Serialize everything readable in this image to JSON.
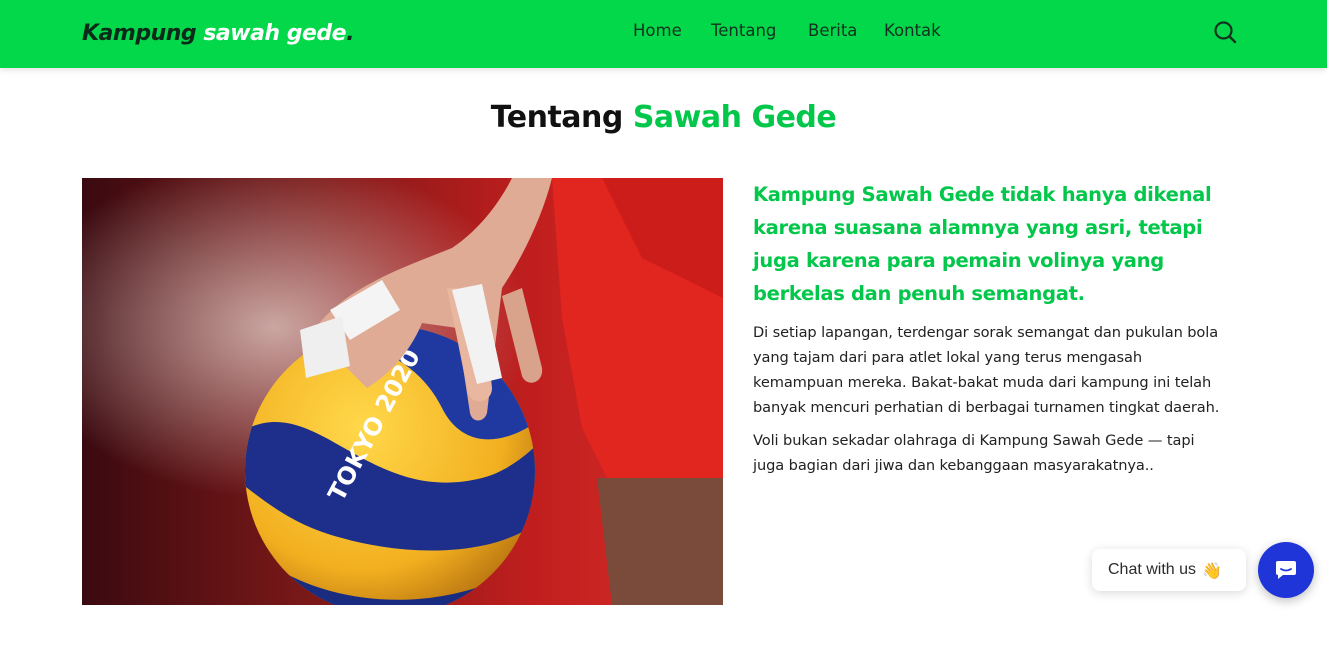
{
  "header": {
    "logo": {
      "part1": "Kampung",
      "part2": "sawah gede",
      "dot": "."
    },
    "nav": [
      "Home",
      "Tentang",
      "Berita",
      "Kontak"
    ],
    "search_icon": "search-icon",
    "background_color": "#02d84a"
  },
  "about": {
    "title_part1": "Tentang",
    "title_part2": "Sawah Gede",
    "lead": "Kampung Sawah Gede tidak hanya dikenal karena suasana alamnya yang asri, tetapi juga karena para pemain volinya yang berkelas dan penuh semangat.",
    "paragraph1": "Di setiap lapangan, terdengar sorak semangat dan pukulan bola yang tajam dari para atlet lokal yang terus mengasah kemampuan mereka. Bakat-bakat muda dari kampung ini telah banyak mencuri perhatian di berbagai turnamen tingkat daerah.",
    "paragraph2": "Voli bukan sekadar olahraga di Kampung Sawah Gede — tapi juga bagian dari jiwa dan kebanggaan masyarakatnya..",
    "image": {
      "ball_text": "TOKYO 2020"
    },
    "accent_color": "#02c74a"
  },
  "chat": {
    "label": "Chat with us",
    "emoji": "👋",
    "launcher_icon": "chat-icon",
    "launcher_color": "#1f35d8"
  }
}
